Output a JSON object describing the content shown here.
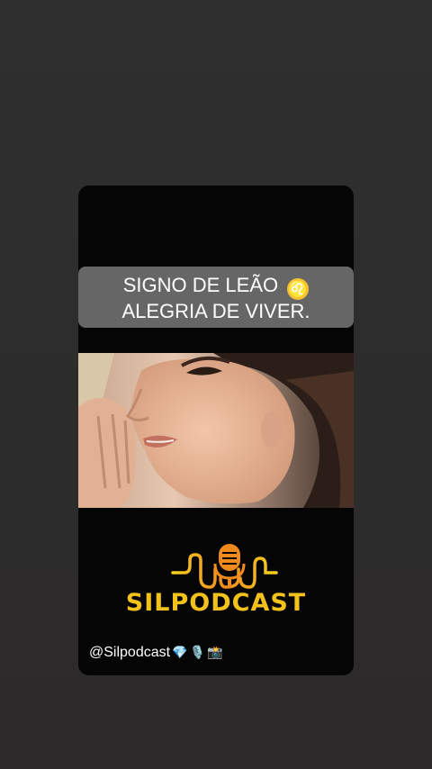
{
  "story": {
    "caption_line1": "SIGNO DE LEÃO",
    "leo_symbol": "♌",
    "caption_line2": "ALEGRIA DE VIVER.",
    "image_description_icon": "whisper-photo",
    "brand_name": "SILPODCAST",
    "handle": "@Silpodcast",
    "handle_emojis": [
      "💎",
      "🎙️",
      "📸"
    ]
  },
  "colors": {
    "background": "#2f2f2f",
    "card": "#050505",
    "caption_bg": "#787878",
    "brand_yellow": "#f2c21b",
    "brand_orange": "#f08a1c"
  }
}
